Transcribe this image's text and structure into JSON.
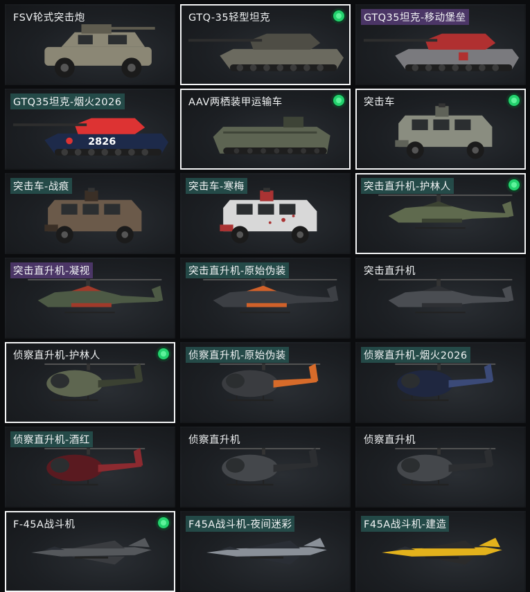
{
  "grid": {
    "items": [
      {
        "label": "FSV轮式突击炮",
        "tag": "none",
        "selected": false,
        "equipped": false,
        "kind": "wheeled",
        "paint": "#8b8775",
        "accent": "#5f5c4f"
      },
      {
        "label": "GTQ-35轻型坦克",
        "tag": "none",
        "selected": true,
        "equipped": true,
        "kind": "tank",
        "paint": "#6b6a5f",
        "accent": "#4e4d45"
      },
      {
        "label": "GTQ35坦克-移动堡垒",
        "tag": "purple",
        "selected": false,
        "equipped": false,
        "kind": "tank",
        "paint": "#7a7a7e",
        "accent": "#b03030"
      },
      {
        "label": "GTQ35坦克-烟火2026",
        "tag": "teal",
        "selected": false,
        "equipped": false,
        "kind": "tank2026",
        "paint": "#1d2a4a",
        "accent": "#d33"
      },
      {
        "label": "AAV两栖装甲运输车",
        "tag": "none",
        "selected": true,
        "equipped": true,
        "kind": "aav",
        "paint": "#5d6452",
        "accent": "#3e4437"
      },
      {
        "label": "突击车",
        "tag": "none",
        "selected": true,
        "equipped": true,
        "kind": "mrap",
        "paint": "#8a8d80",
        "accent": "#5f6258"
      },
      {
        "label": "突击车-战痕",
        "tag": "teal",
        "selected": false,
        "equipped": false,
        "kind": "mrap",
        "paint": "#6b5a4a",
        "accent": "#3a2f26"
      },
      {
        "label": "突击车-寒梅",
        "tag": "teal",
        "selected": false,
        "equipped": false,
        "kind": "mrap",
        "paint": "#d8d8d8",
        "accent": "#a33"
      },
      {
        "label": "突击直升机-护林人",
        "tag": "teal",
        "selected": true,
        "equipped": true,
        "kind": "attackheli",
        "paint": "#5f6a4e",
        "accent": "#3b4232"
      },
      {
        "label": "突击直升机-凝视",
        "tag": "purple",
        "selected": false,
        "equipped": false,
        "kind": "attackheli",
        "paint": "#4d5a45",
        "accent": "#a03a2a"
      },
      {
        "label": "突击直升机-原始伪装",
        "tag": "teal",
        "selected": false,
        "equipped": false,
        "kind": "attackheli",
        "paint": "#3c3f44",
        "accent": "#d0612a"
      },
      {
        "label": "突击直升机",
        "tag": "none",
        "selected": false,
        "equipped": false,
        "kind": "attackheli",
        "paint": "#4a4d52",
        "accent": "#2e3034"
      },
      {
        "label": "侦察直升机-护林人",
        "tag": "none",
        "selected": true,
        "equipped": true,
        "kind": "scoutheli",
        "paint": "#5e6650",
        "accent": "#3b4132"
      },
      {
        "label": "侦察直升机-原始伪装",
        "tag": "teal",
        "selected": false,
        "equipped": false,
        "kind": "scoutheli",
        "paint": "#3a3c40",
        "accent": "#d76b2a"
      },
      {
        "label": "侦察直升机-烟火2026",
        "tag": "teal",
        "selected": false,
        "equipped": false,
        "kind": "scoutheli",
        "paint": "#1f2740",
        "accent": "#3b4a78"
      },
      {
        "label": "侦察直升机-酒红",
        "tag": "teal",
        "selected": false,
        "equipped": false,
        "kind": "scoutheli",
        "paint": "#5a1a20",
        "accent": "#8c2a30"
      },
      {
        "label": "侦察直升机",
        "tag": "none",
        "selected": false,
        "equipped": false,
        "kind": "scoutheli",
        "paint": "#44474b",
        "accent": "#2c2e31"
      },
      {
        "label": "侦察直升机",
        "tag": "none",
        "selected": false,
        "equipped": false,
        "kind": "scoutheli",
        "paint": "#44474b",
        "accent": "#2c2e31"
      },
      {
        "label": "F-45A战斗机",
        "tag": "none",
        "selected": true,
        "equipped": true,
        "kind": "jet",
        "paint": "#55585c",
        "accent": "#3a3c40"
      },
      {
        "label": "F45A战斗机-夜间迷彩",
        "tag": "teal",
        "selected": false,
        "equipped": false,
        "kind": "jet",
        "paint": "#8a9098",
        "accent": "#2a2e35"
      },
      {
        "label": "F45A战斗机-建造",
        "tag": "teal",
        "selected": false,
        "equipped": false,
        "kind": "jet",
        "paint": "#e3b21c",
        "accent": "#2b2b2b"
      }
    ]
  }
}
